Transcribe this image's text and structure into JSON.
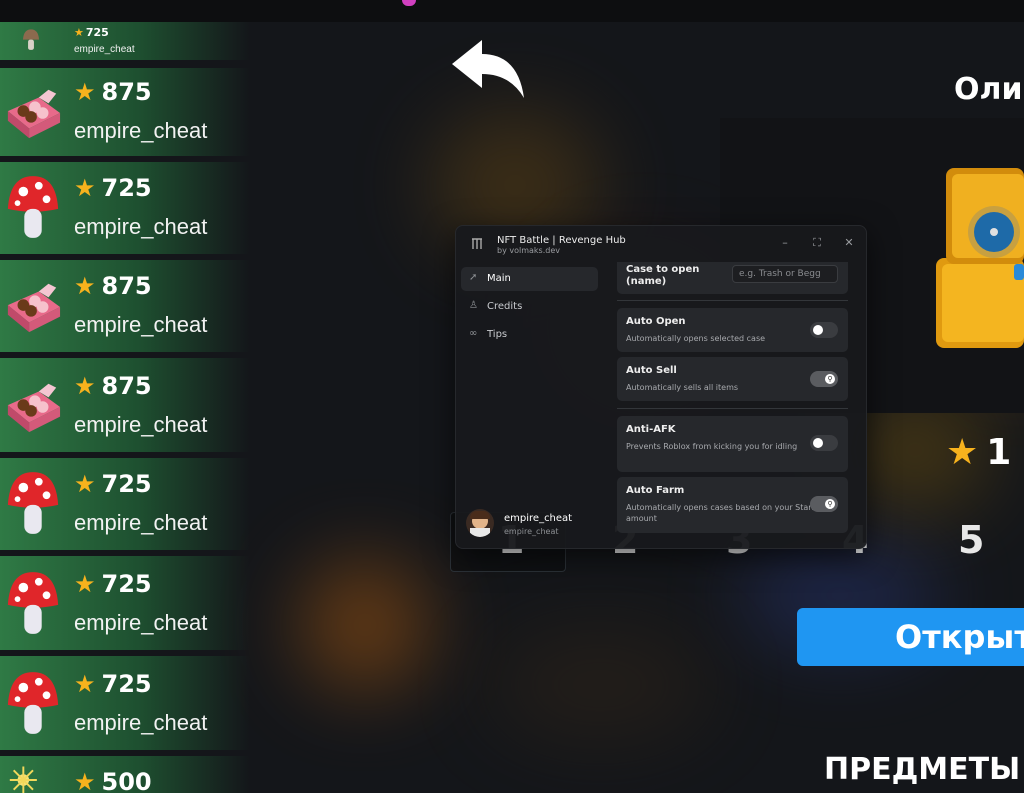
{
  "feed": [
    {
      "stars": "725",
      "user": "empire_cheat",
      "item": "mushroom-icon"
    },
    {
      "stars": "875",
      "user": "empire_cheat",
      "item": "chocolate-box-icon"
    },
    {
      "stars": "725",
      "user": "empire_cheat",
      "item": "mushroom-icon"
    },
    {
      "stars": "875",
      "user": "empire_cheat",
      "item": "chocolate-box-icon"
    },
    {
      "stars": "875",
      "user": "empire_cheat",
      "item": "chocolate-box-icon"
    },
    {
      "stars": "725",
      "user": "empire_cheat",
      "item": "mushroom-icon"
    },
    {
      "stars": "725",
      "user": "empire_cheat",
      "item": "mushroom-icon"
    },
    {
      "stars": "725",
      "user": "empire_cheat",
      "item": "mushroom-icon"
    },
    {
      "stars": "500",
      "user": "",
      "item": "sparkler-icon"
    }
  ],
  "game": {
    "case_title": "Оли",
    "price": "1",
    "page_numbers": [
      "1",
      "2",
      "3",
      "4",
      "5"
    ],
    "open_button": "Открыт",
    "items_title": "ПРЕДМЕТЫ"
  },
  "hub": {
    "title": "NFT Battle | Revenge Hub",
    "subtitle": "by volmaks.dev",
    "nav": [
      {
        "label": "Main",
        "icon": "rocket-icon"
      },
      {
        "label": "Credits",
        "icon": "person-icon"
      },
      {
        "label": "Tips",
        "icon": "link-icon"
      }
    ],
    "case_to_open": {
      "label": "Case to open (name)",
      "placeholder": "e.g. Trash or Begg"
    },
    "options": [
      {
        "title": "Auto Open",
        "desc": "Automatically opens selected case",
        "state": "off"
      },
      {
        "title": "Auto Sell",
        "desc": "Automatically sells all items",
        "state": "on"
      },
      {
        "title": "Anti-AFK",
        "desc": "Prevents Roblox from kicking you for idling",
        "state": "off"
      },
      {
        "title": "Auto Farm",
        "desc": "Automatically opens cases based on your Stars amount",
        "state": "on"
      }
    ],
    "user": {
      "name": "empire_cheat",
      "handle": "empire_cheat"
    }
  },
  "colors": {
    "accent": "#1f96f2",
    "star": "#f7b21d",
    "card_green": "#2f7a45"
  }
}
